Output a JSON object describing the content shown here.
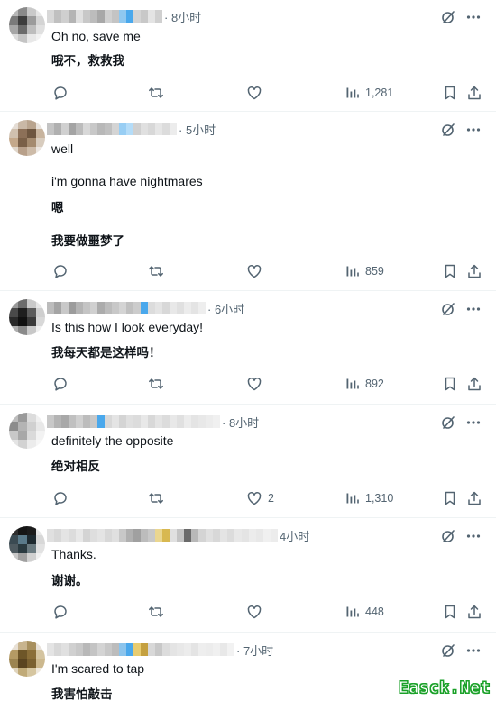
{
  "replies": [
    {
      "time": "· 8小时",
      "lines": [
        "Oh no, save me",
        "哦不，救救我"
      ],
      "counts": {
        "reply": "",
        "repost": "",
        "like": "",
        "views": "1,281"
      }
    },
    {
      "time": "· 5小时",
      "lines": [
        "well",
        "i'm gonna have nightmares",
        "嗯",
        "我要做噩梦了"
      ],
      "counts": {
        "reply": "",
        "repost": "",
        "like": "",
        "views": "859"
      }
    },
    {
      "time": "· 6小时",
      "lines": [
        "Is this how I look everyday!",
        "我每天都是这样吗！"
      ],
      "counts": {
        "reply": "",
        "repost": "",
        "like": "",
        "views": "892"
      }
    },
    {
      "time": "· 8小时",
      "lines": [
        "definitely the opposite",
        "绝对相反"
      ],
      "counts": {
        "reply": "",
        "repost": "",
        "like": "2",
        "views": "1,310"
      }
    },
    {
      "time": "4小时",
      "lines": [
        "Thanks.",
        "谢谢。"
      ],
      "counts": {
        "reply": "",
        "repost": "",
        "like": "",
        "views": "448"
      }
    },
    {
      "time": "· 7小时",
      "lines": [
        "I'm scared to tap",
        "我害怕敲击"
      ],
      "counts": {}
    }
  ],
  "watermark": "Easck.Net",
  "colors": {
    "text": "#0f1419",
    "muted": "#536471",
    "divider": "#eff3f4",
    "accent": "#1d9bf0",
    "watermark": "#1aa128"
  },
  "icons": [
    "grok-icon",
    "more-icon",
    "reply-icon",
    "repost-icon",
    "like-icon",
    "views-icon",
    "bookmark-icon",
    "share-icon"
  ]
}
